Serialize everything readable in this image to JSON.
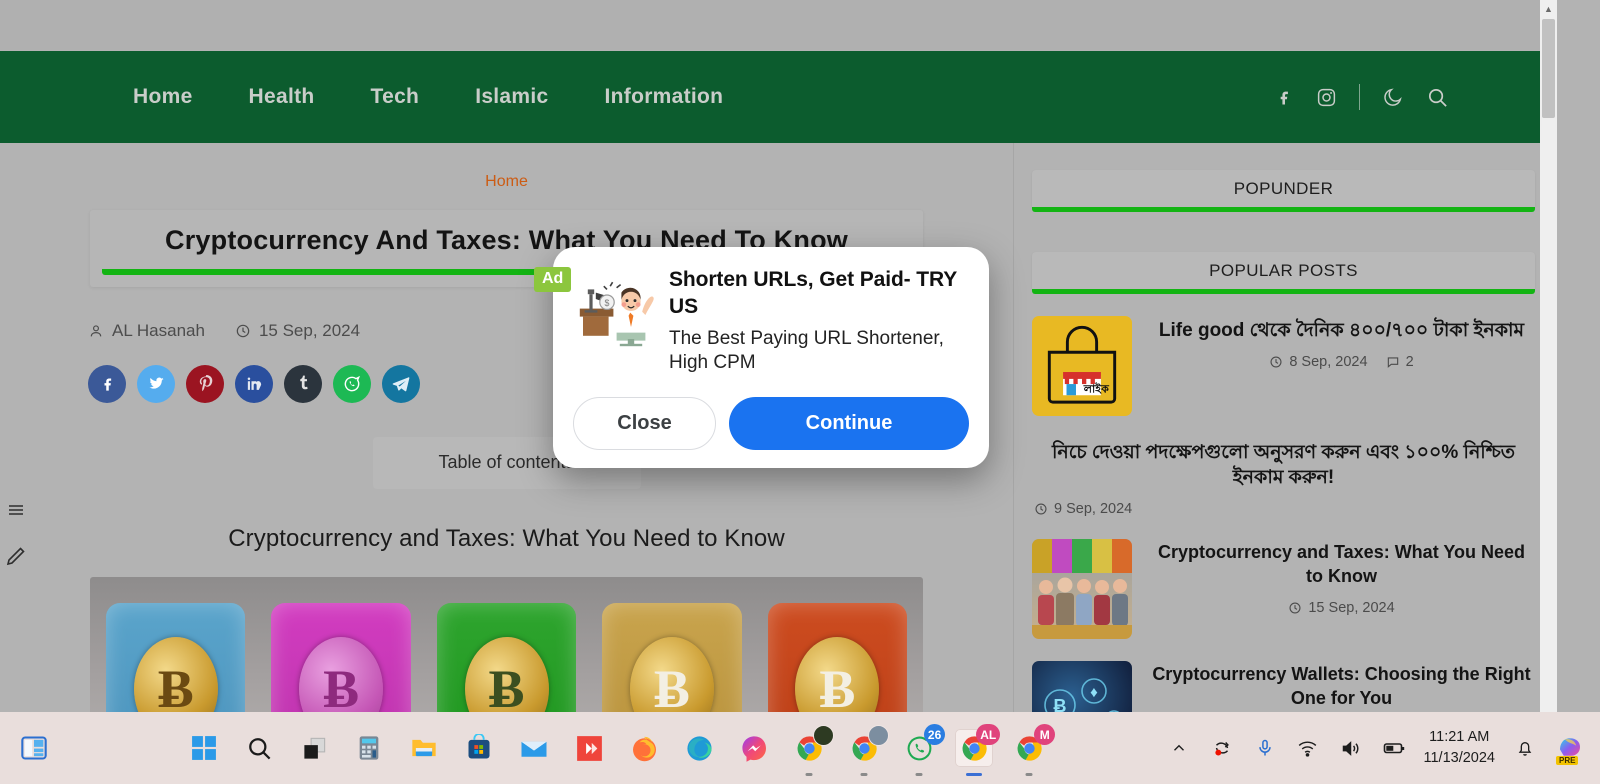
{
  "site": {
    "nav": [
      {
        "label": "Home"
      },
      {
        "label": "Health"
      },
      {
        "label": "Tech"
      },
      {
        "label": "Islamic"
      },
      {
        "label": "Information"
      }
    ],
    "nav_icons": [
      "facebook-icon",
      "instagram-icon",
      "dark-mode-moon-icon",
      "search-icon"
    ]
  },
  "article": {
    "breadcrumb": "Home",
    "title": "Cryptocurrency And Taxes: What You Need To Know",
    "author": "AL Hasanah",
    "date": "15 Sep, 2024",
    "toc_label": "Table of contents",
    "heading": "Cryptocurrency and Taxes: What You Need to Know",
    "share_buttons": [
      {
        "name": "facebook",
        "color": "#3b5998",
        "glyph": "f"
      },
      {
        "name": "twitter",
        "color": "#55acee",
        "glyph": "t"
      },
      {
        "name": "pinterest",
        "color": "#9b1421",
        "glyph": "p"
      },
      {
        "name": "linkedin",
        "color": "#2a4f9e",
        "glyph": "in"
      },
      {
        "name": "tumblr",
        "color": "#2b343d",
        "glyph": "t"
      },
      {
        "name": "whatsapp",
        "color": "#1db954",
        "glyph": "w"
      },
      {
        "name": "telegram",
        "color": "#1476a0",
        "glyph": "s"
      }
    ],
    "hero_coins": [
      {
        "frame": "#5ba3c9",
        "symbol": "Ƀ",
        "symbol_color": "#6b4a12"
      },
      {
        "frame": "#d03bbd",
        "symbol": "Ƀ",
        "symbol_color": "#8e2a7e"
      },
      {
        "frame": "#2aa02a",
        "symbol": "Ƀ",
        "symbol_color": "#3c4f20"
      },
      {
        "frame": "#c8a24a",
        "symbol": "Ƀ",
        "symbol_color": "#f0ece0"
      },
      {
        "frame": "#cc4a1e",
        "symbol": "Ƀ",
        "symbol_color": "#f0ece0"
      }
    ]
  },
  "edge_tools": [
    {
      "name": "menu-toggle",
      "icon": "hamburger-icon"
    },
    {
      "name": "edit-tool",
      "icon": "pencil-icon"
    }
  ],
  "sidebar": {
    "widgets": [
      {
        "title": "POPUNDER"
      },
      {
        "title": "POPULAR POSTS"
      }
    ],
    "posts": [
      {
        "title": "Life good থেকে দৈনিক ৪০০/৭০০ টাকা ইনকাম",
        "date": "8 Sep, 2024",
        "comments": "2",
        "thumb": "shopping-bag-thumbnail"
      },
      {
        "title": "নিচে দেওয়া পদক্ষেপগুলো অনুসরণ করুন এবং ১০০% নিশ্চিত ইনকাম করুন!",
        "date": "9 Sep, 2024",
        "comments": "",
        "thumb": ""
      },
      {
        "title": "Cryptocurrency and Taxes: What You Need to Know",
        "date": "15 Sep, 2024",
        "comments": "",
        "thumb": "crypto-people-thumbnail"
      },
      {
        "title": "Cryptocurrency Wallets: Choosing the Right One for You",
        "date": "",
        "comments": "",
        "thumb": "crypto-wallet-thumbnail"
      }
    ]
  },
  "ad_modal": {
    "badge": "Ad",
    "image": "man-at-desk-getting-money-illustration",
    "title": "Shorten URLs, Get Paid- TRY US",
    "description": "The Best Paying URL Shortener, High CPM",
    "close_label": "Close",
    "continue_label": "Continue",
    "continue_color": "#1a73f0"
  },
  "taskbar": {
    "widgets_button": "widgets-icon",
    "items": [
      {
        "name": "start-button",
        "icon": "windows-logo-icon"
      },
      {
        "name": "search-button",
        "icon": "search-icon"
      },
      {
        "name": "task-view-button",
        "icon": "task-view-icon"
      },
      {
        "name": "calculator",
        "icon": "calculator-icon"
      },
      {
        "name": "file-explorer",
        "icon": "folder-icon"
      },
      {
        "name": "microsoft-store",
        "icon": "store-icon"
      },
      {
        "name": "mail",
        "icon": "mail-icon"
      },
      {
        "name": "anydesk",
        "icon": "anydesk-icon"
      },
      {
        "name": "firefox",
        "icon": "firefox-icon"
      },
      {
        "name": "microsoft-edge",
        "icon": "edge-icon"
      },
      {
        "name": "messenger",
        "icon": "messenger-icon"
      },
      {
        "name": "chrome-profile-1",
        "icon": "chrome-icon"
      },
      {
        "name": "chrome-profile-2",
        "icon": "chrome-icon"
      },
      {
        "name": "whatsapp",
        "icon": "whatsapp-icon",
        "badge": "26"
      },
      {
        "name": "chrome-profile-al",
        "icon": "chrome-icon",
        "badge": "AL"
      },
      {
        "name": "chrome-profile-m",
        "icon": "chrome-icon",
        "badge": "M"
      }
    ],
    "tray": [
      {
        "name": "show-hidden-icons",
        "icon": "chevron-up-icon"
      },
      {
        "name": "screen-recorder",
        "icon": "record-icon"
      },
      {
        "name": "microphone",
        "icon": "microphone-icon"
      },
      {
        "name": "network",
        "icon": "wifi-icon"
      },
      {
        "name": "volume",
        "icon": "speaker-icon"
      },
      {
        "name": "battery",
        "icon": "battery-icon"
      }
    ],
    "clock_time": "11:21 AM",
    "clock_date": "11/13/2024",
    "notifications_icon": "bell-icon",
    "copilot": {
      "name": "copilot",
      "tag": "PRE"
    }
  }
}
